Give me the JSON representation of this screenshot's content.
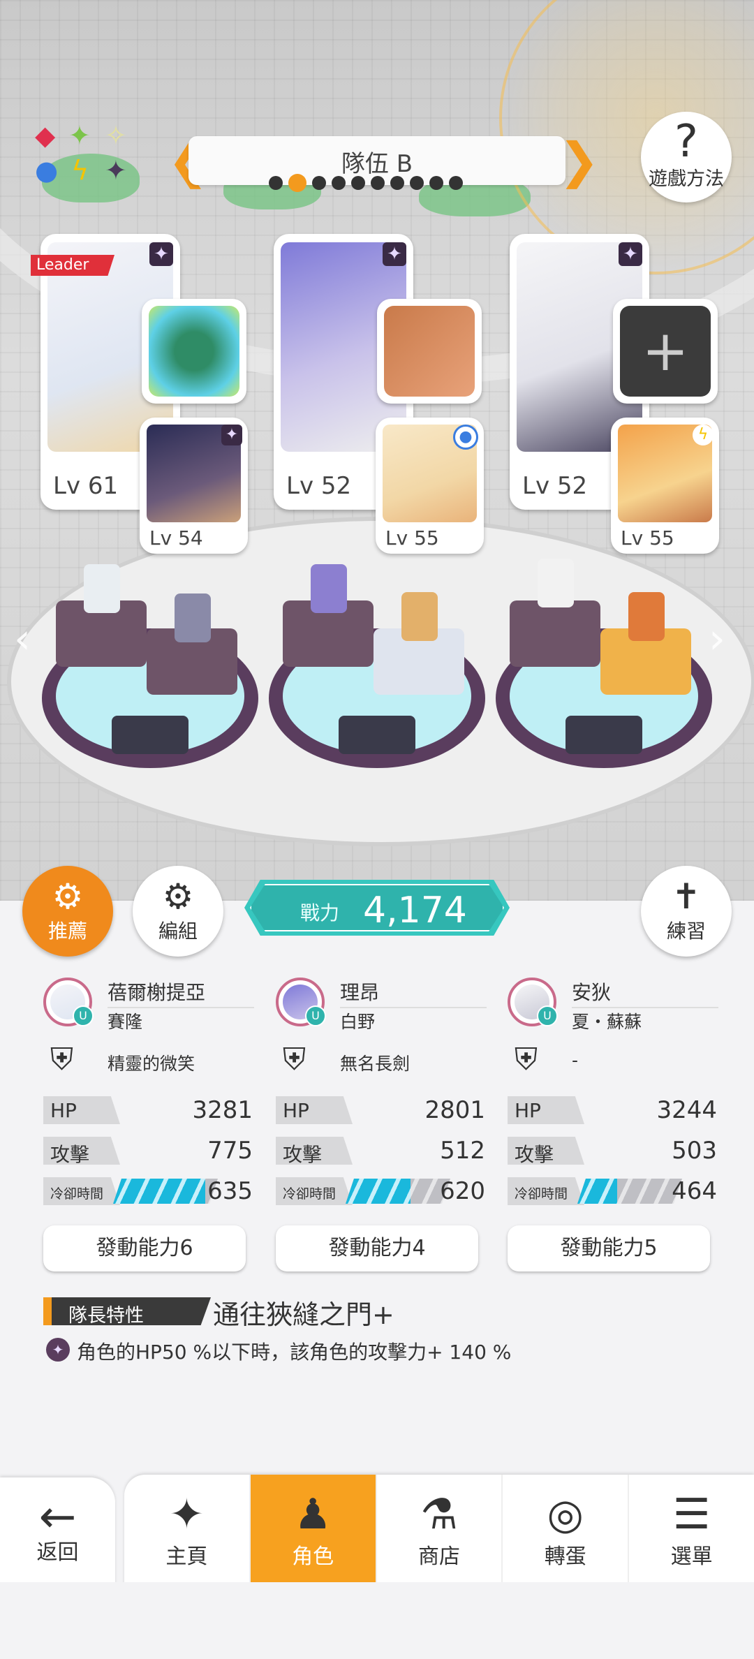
{
  "team": {
    "name": "隊伍 B",
    "page_count": 10,
    "active_page": 2
  },
  "help": {
    "icon": "question-mark-icon",
    "label": "遊戲方法"
  },
  "leader_badge": "Leader",
  "main_chars": [
    {
      "level": "Lv 61",
      "element": "dark",
      "equip_color": "#3fbfa6"
    },
    {
      "level": "Lv 52",
      "element": "dark",
      "equip_color": "#c97a4a"
    },
    {
      "level": "Lv 52",
      "element": "dark",
      "equip_color": "#3b3b3b"
    }
  ],
  "sub_chars": [
    {
      "level": "Lv 54",
      "element": "dark"
    },
    {
      "level": "Lv 55",
      "element": "water"
    },
    {
      "level": "Lv 55",
      "element": "lightning"
    }
  ],
  "buttons": {
    "recommend": "推薦",
    "edit": "編組",
    "practice": "練習"
  },
  "power": {
    "label": "戰力",
    "value": "4,174"
  },
  "columns": [
    {
      "char_name": "蓓爾榭提亞",
      "user": "賽隆",
      "weapon": "精靈的微笑",
      "hp_label": "HP",
      "hp": "3281",
      "atk_label": "攻擊",
      "atk": "775",
      "cd_label": "冷卻時間",
      "cd": "635",
      "cd_fill": 0.88,
      "skill": "發動能力6"
    },
    {
      "char_name": "理昂",
      "user": "白野",
      "weapon": "無名長劍",
      "hp_label": "HP",
      "hp": "2801",
      "atk_label": "攻擊",
      "atk": "512",
      "cd_label": "冷卻時間",
      "cd": "620",
      "cd_fill": 0.62,
      "skill": "發動能力4"
    },
    {
      "char_name": "安狄",
      "user": "夏・蘇蘇",
      "weapon": "-",
      "hp_label": "HP",
      "hp": "3244",
      "atk_label": "攻擊",
      "atk": "503",
      "cd_label": "冷卻時間",
      "cd": "464",
      "cd_fill": 0.38,
      "skill": "發動能力5"
    }
  ],
  "leader_trait": {
    "tag": "隊長特性",
    "name": "通往狹縫之門+",
    "description": "角色的HP50 %以下時，該角色的攻擊力+ 140 %"
  },
  "nav": {
    "back": "返回",
    "tabs": [
      {
        "label": "主頁",
        "icon": "home-icon"
      },
      {
        "label": "角色",
        "icon": "character-icon"
      },
      {
        "label": "商店",
        "icon": "shop-icon"
      },
      {
        "label": "轉蛋",
        "icon": "gacha-icon"
      },
      {
        "label": "選單",
        "icon": "menu-icon"
      }
    ],
    "active_tab": 1
  },
  "colors": {
    "accent": "#f39a1e",
    "teal": "#2fb3ac",
    "cooldown": "#1ab8dc"
  }
}
